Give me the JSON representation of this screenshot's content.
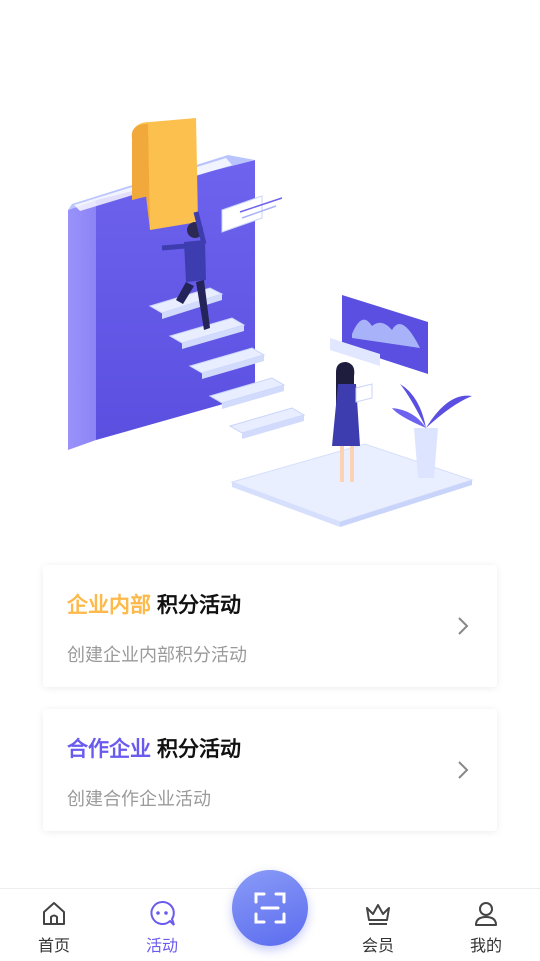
{
  "cards": [
    {
      "highlight": "企业内部",
      "title": "积分活动",
      "subtitle": "创建企业内部积分活动"
    },
    {
      "highlight": "合作企业",
      "title": "积分活动",
      "subtitle": "创建合作企业活动"
    }
  ],
  "tabbar": {
    "items": [
      {
        "label": "首页",
        "icon": "home-icon"
      },
      {
        "label": "活动",
        "icon": "chat-icon",
        "active": true
      },
      {
        "label": "会员",
        "icon": "crown-icon"
      },
      {
        "label": "我的",
        "icon": "user-icon"
      }
    ],
    "center": {
      "icon": "scan-icon"
    }
  },
  "colors": {
    "accent": "#6A5BEF",
    "highlight_yellow": "#FDB94A",
    "highlight_purple": "#6A5BEF"
  }
}
